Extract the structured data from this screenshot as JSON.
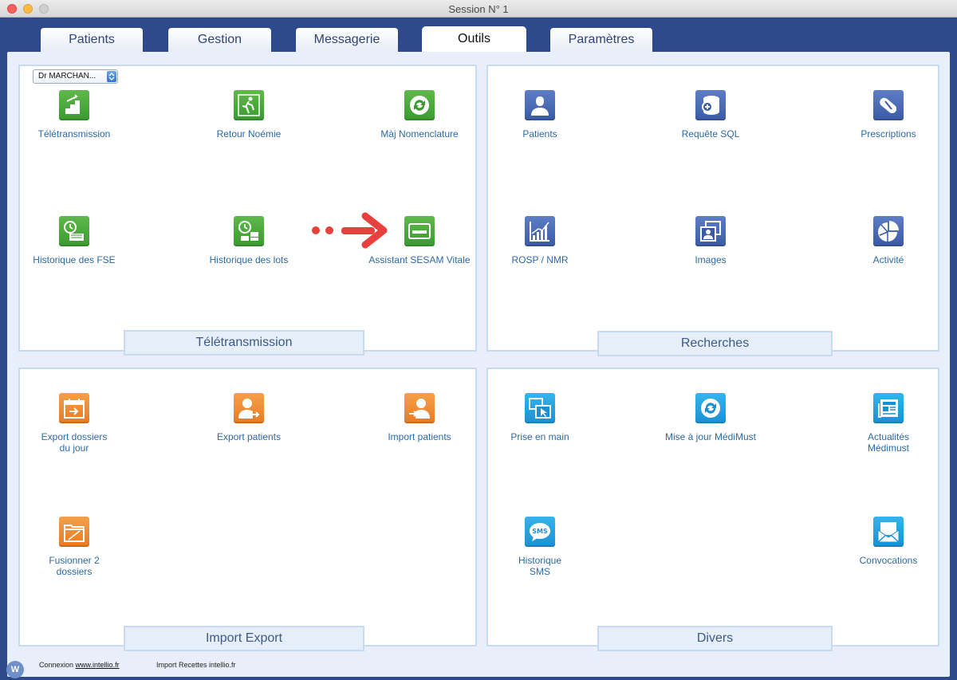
{
  "window": {
    "title": "Session N° 1"
  },
  "tabs": [
    {
      "label": "Patients",
      "active": false
    },
    {
      "label": "Gestion",
      "active": false
    },
    {
      "label": "Messagerie",
      "active": false
    },
    {
      "label": "Outils",
      "active": true
    },
    {
      "label": "Paramètres",
      "active": false
    }
  ],
  "doctor_select": {
    "value": "Dr MARCHAN..."
  },
  "panels": {
    "teletransmission": {
      "label": "Télétransmission",
      "items": [
        {
          "label": "Télétransmission",
          "icon": "stairs-icon",
          "color": "#3a9a31"
        },
        {
          "label": "Retour Noémie",
          "icon": "runner-icon",
          "color": "#3a9a31"
        },
        {
          "label": "Màj Nomenclature",
          "icon": "refresh-icon",
          "color": "#3a9a31"
        },
        {
          "label": "Historique des FSE",
          "icon": "clock-cards-icon",
          "color": "#3a9a31"
        },
        {
          "label": "Historique des lots",
          "icon": "clock-stack-icon",
          "color": "#3a9a31"
        },
        {
          "label": "Assistant SESAM Vitale",
          "icon": "card-icon",
          "color": "#3a9a31"
        }
      ]
    },
    "recherches": {
      "label": "Recherches",
      "items": [
        {
          "label": "Patients",
          "icon": "patient-icon",
          "color": "#3b5aa6"
        },
        {
          "label": "Requête SQL",
          "icon": "database-search-icon",
          "color": "#3b5aa6"
        },
        {
          "label": "Prescriptions",
          "icon": "pill-icon",
          "color": "#3b5aa6"
        },
        {
          "label": "ROSP / NMR",
          "icon": "bar-chart-icon",
          "color": "#3b5aa6"
        },
        {
          "label": "Images",
          "icon": "images-icon",
          "color": "#3b5aa6"
        },
        {
          "label": "Activité",
          "icon": "pie-chart-icon",
          "color": "#3b5aa6"
        }
      ]
    },
    "import_export": {
      "label": "Import Export",
      "items": [
        {
          "label_line1": "Export dossiers",
          "label_line2": "du jour",
          "icon": "calendar-export-icon",
          "color": "#e97a22"
        },
        {
          "label_line1": "Export patients",
          "label_line2": "",
          "icon": "user-export-icon",
          "color": "#e97a22"
        },
        {
          "label_line1": "Import patients",
          "label_line2": "",
          "icon": "user-import-icon",
          "color": "#e97a22"
        },
        {
          "label_line1": "Fusionner 2",
          "label_line2": "dossiers",
          "icon": "folder-merge-icon",
          "color": "#e97a22"
        }
      ]
    },
    "divers": {
      "label": "Divers",
      "items": [
        {
          "label_line1": "Prise en main",
          "label_line2": "",
          "icon": "remote-control-icon",
          "color": "#1a90d4"
        },
        {
          "label_line1": "Mise à jour MédiMust",
          "label_line2": "",
          "icon": "update-icon",
          "color": "#1a90d4"
        },
        {
          "label_line1": "Actualités",
          "label_line2": "Médimust",
          "icon": "news-icon",
          "color": "#1a90d4"
        },
        {
          "label_line1": "Historique",
          "label_line2": "SMS",
          "icon": "sms-icon",
          "color": "#1a90d4"
        },
        {
          "label_line1": "Convocations",
          "label_line2": "",
          "icon": "envelope-icon",
          "color": "#1a90d4"
        }
      ]
    }
  },
  "sms_badge": "SMS",
  "footer": {
    "connexion_prefix": "Connexion",
    "connexion_link": "www.intellio.fr",
    "import_recettes": "Import Recettes intellio.fr",
    "logo_letter": "W"
  },
  "colors": {
    "accent": "#2f4a8c",
    "arrow": "#e8403c",
    "label_text": "#2c6aa5"
  }
}
